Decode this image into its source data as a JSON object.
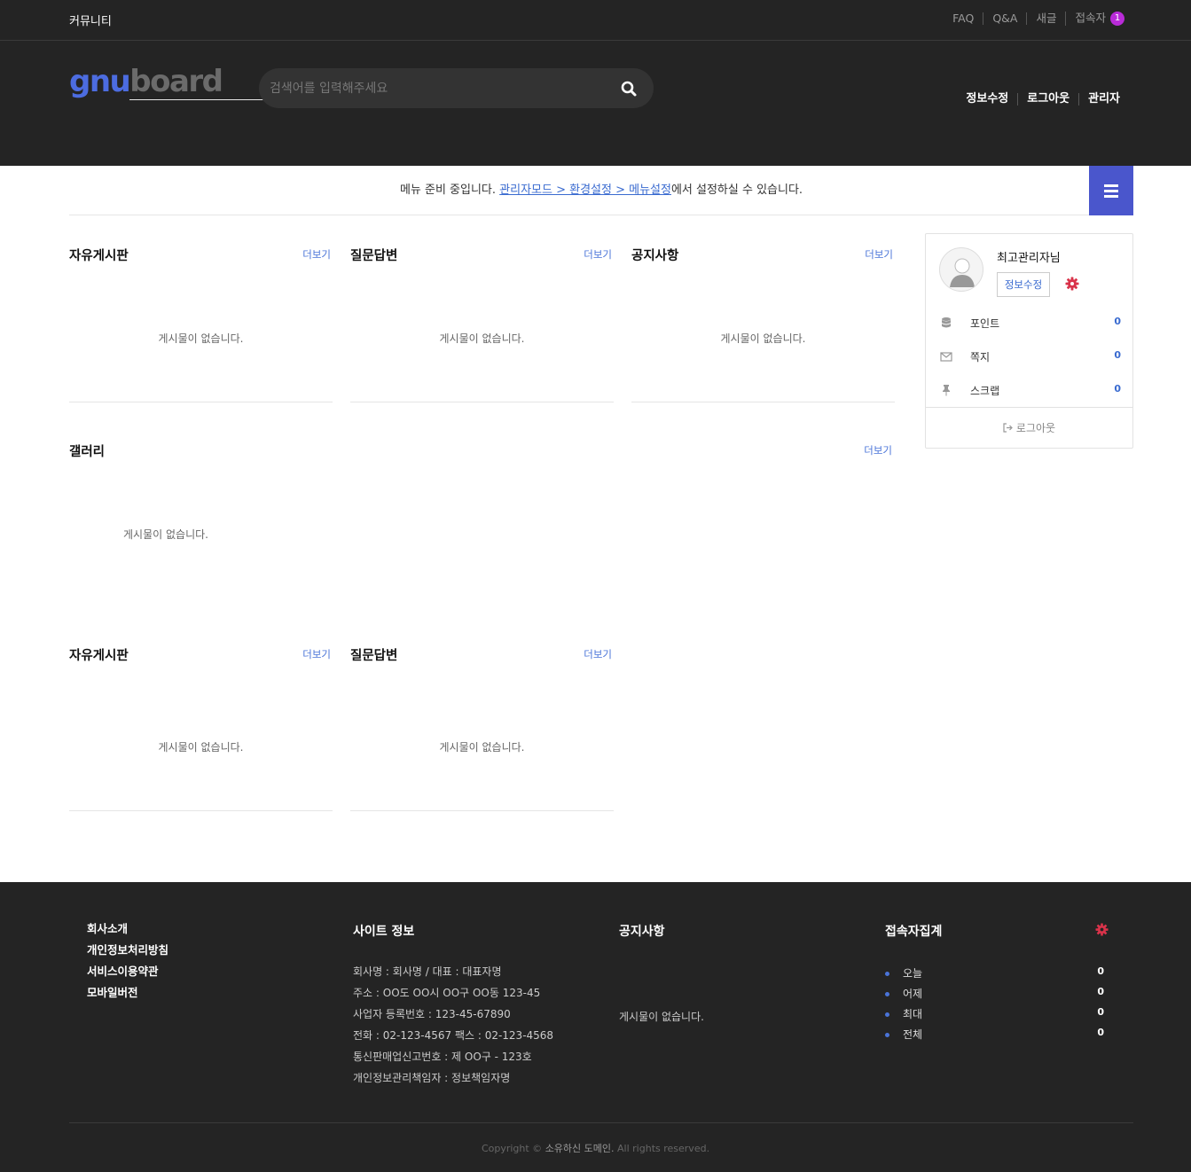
{
  "topbar": {
    "community": "커뮤니티",
    "links": [
      "FAQ",
      "Q&A",
      "새글",
      "접속자"
    ],
    "visitor_badge": "1"
  },
  "header": {
    "logo_gnu": "gnu",
    "logo_board": "board",
    "search_placeholder": "검색어를 입력해주세요",
    "links": [
      "정보수정",
      "로그아웃",
      "관리자"
    ]
  },
  "notice": {
    "prefix": "메뉴 준비 중입니다. ",
    "link": "관리자모드 > 환경설정 > 메뉴설정",
    "suffix": "에서 설정하실 수 있습니다."
  },
  "boards": {
    "more": "더보기",
    "empty": "게시물이 없습니다.",
    "free1": "자유게시판",
    "qa1": "질문답변",
    "notice1": "공지사항",
    "gallery": "갤러리",
    "free2": "자유게시판",
    "qa2": "질문답변"
  },
  "profile": {
    "name": "최고관리자님",
    "edit": "정보수정",
    "rows": [
      {
        "label": "포인트",
        "value": "0",
        "icon": "database-icon"
      },
      {
        "label": "쪽지",
        "value": "0",
        "icon": "envelope-icon"
      },
      {
        "label": "스크랩",
        "value": "0",
        "icon": "pin-icon"
      }
    ],
    "logout": "로그아웃"
  },
  "footer": {
    "links": [
      "회사소개",
      "개인정보처리방침",
      "서비스이용약관",
      "모바일버전"
    ],
    "site_info_title": "사이트 정보",
    "site_info": [
      "회사명 : 회사명 / 대표 : 대표자명",
      "주소 : OO도 OO시 OO구 OO동 123-45",
      "사업자 등록번호 : 123-45-67890",
      "전화 : 02-123-4567 팩스 : 02-123-4568",
      "통신판매업신고번호 : 제 OO구 - 123호",
      "개인정보관리책임자 : 정보책임자명"
    ],
    "notice_title": "공지사항",
    "notice_empty": "게시물이 없습니다.",
    "visitor_title": "접속자집계",
    "visitors": [
      {
        "label": "오늘",
        "value": "0"
      },
      {
        "label": "어제",
        "value": "0"
      },
      {
        "label": "최대",
        "value": "0"
      },
      {
        "label": "전체",
        "value": "0"
      }
    ],
    "copyright_prefix": "Copyright © ",
    "copyright_domain": "소유하신 도메인.",
    "copyright_suffix": " All rights reserved."
  },
  "colors": {
    "dark_bg": "#242424",
    "accent_blue": "#4a56cc",
    "link_blue": "#3a6bd0",
    "badge_purple": "#b92bd8",
    "gear_red": "#d9334a"
  }
}
